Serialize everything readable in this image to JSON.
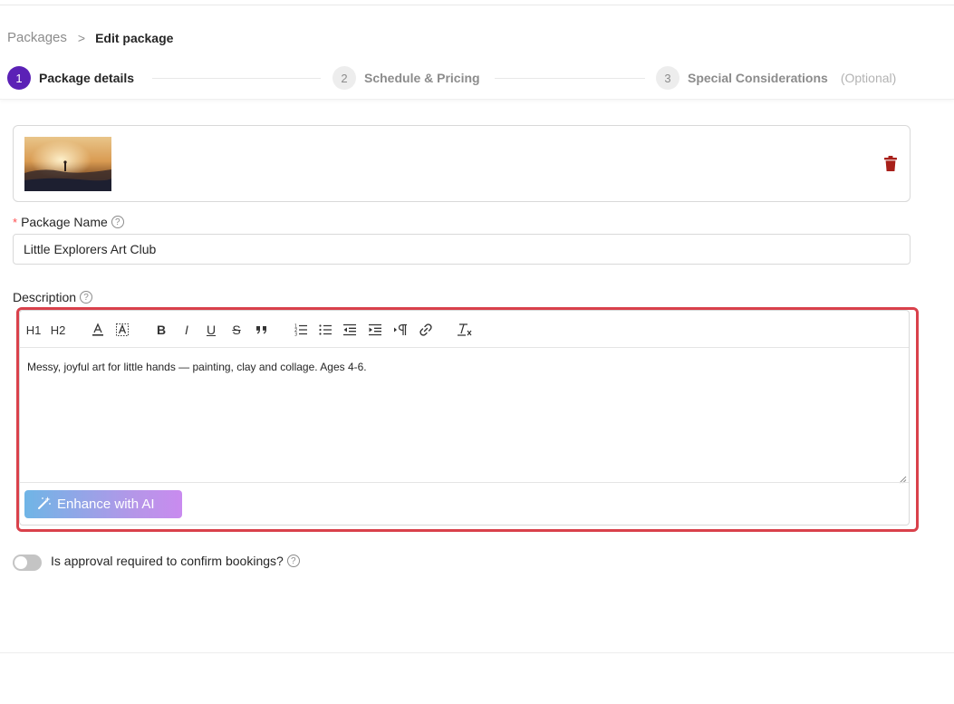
{
  "breadcrumb": {
    "parent": "Packages",
    "separator": ">",
    "current": "Edit package"
  },
  "steps": [
    {
      "number": "1",
      "label": "Package details",
      "optional": "",
      "active": true
    },
    {
      "number": "2",
      "label": "Schedule & Pricing",
      "optional": "",
      "active": false
    },
    {
      "number": "3",
      "label": "Special Considerations",
      "optional": "(Optional)",
      "active": false
    }
  ],
  "form": {
    "package_name": {
      "required_mark": "*",
      "label": "Package Name",
      "value": "Little Explorers Art Club"
    },
    "description": {
      "label": "Description",
      "content": "Messy, joyful art for little hands — painting, clay and collage. Ages 4-6.",
      "toolbar": {
        "h1": "H1",
        "h2": "H2",
        "bold": "B",
        "italic": "I",
        "underline": "U",
        "strike": "S"
      },
      "enhance_label": "Enhance with AI"
    },
    "approval": {
      "label": "Is approval required to confirm bookings?",
      "enabled": false
    }
  },
  "colors": {
    "accent": "#5b21b6",
    "highlight": "#d9414b",
    "delete": "#a8201a"
  }
}
